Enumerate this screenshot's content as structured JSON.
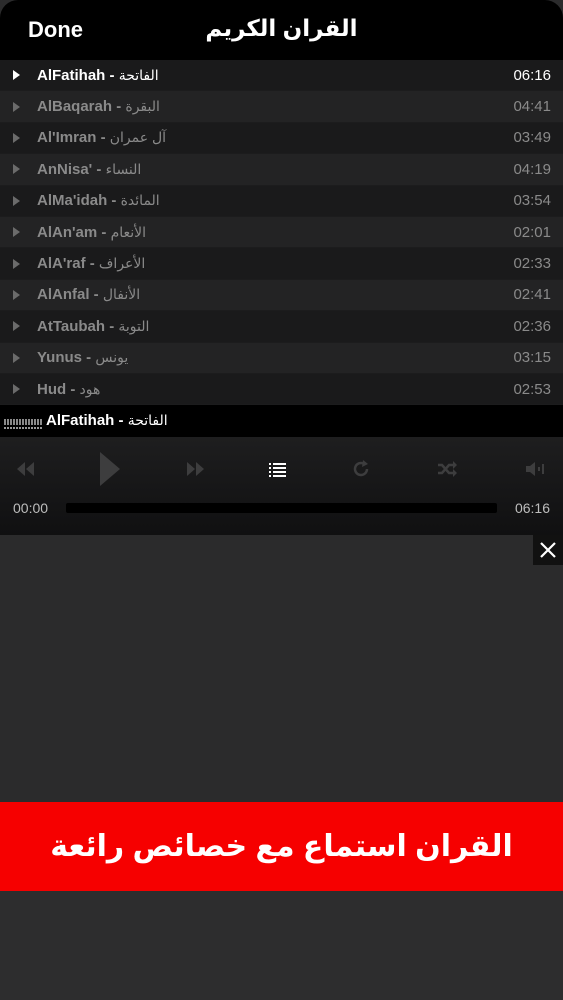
{
  "header": {
    "done_label": "Done",
    "title": "القران الكريم"
  },
  "tracks": [
    {
      "name": "AlFatihah",
      "arabic": "الفاتحة",
      "duration": "06:16",
      "active": true
    },
    {
      "name": "AlBaqarah",
      "arabic": "البقرة",
      "duration": "04:41",
      "active": false
    },
    {
      "name": "Al'Imran",
      "arabic": "آل عمران",
      "duration": "03:49",
      "active": false
    },
    {
      "name": "AnNisa'",
      "arabic": "النساء",
      "duration": "04:19",
      "active": false
    },
    {
      "name": "AlMa'idah",
      "arabic": "المائدة",
      "duration": "03:54",
      "active": false
    },
    {
      "name": "AlAn'am",
      "arabic": "الأنعام",
      "duration": "02:01",
      "active": false
    },
    {
      "name": "AlA'raf",
      "arabic": "الأعراف",
      "duration": "02:33",
      "active": false
    },
    {
      "name": "AlAnfal",
      "arabic": "الأنفال",
      "duration": "02:41",
      "active": false
    },
    {
      "name": "AtTaubah",
      "arabic": "التوبة",
      "duration": "02:36",
      "active": false
    },
    {
      "name": "Yunus",
      "arabic": "يونس",
      "duration": "03:15",
      "active": false
    },
    {
      "name": "Hud",
      "arabic": "هود",
      "duration": "02:53",
      "active": false
    }
  ],
  "now_playing": {
    "name": "AlFatihah",
    "arabic": "الفاتحة",
    "elapsed": "00:00",
    "total": "06:16",
    "progress": 0
  },
  "controls": {
    "icons": [
      "rewind-icon",
      "play-icon",
      "fast-forward-icon",
      "playlist-icon",
      "repeat-icon",
      "shuffle-icon",
      "volume-icon"
    ]
  },
  "ad": {
    "banner_text": "القران استماع مع خصائص رائعة",
    "banner_color": "#f60000"
  }
}
